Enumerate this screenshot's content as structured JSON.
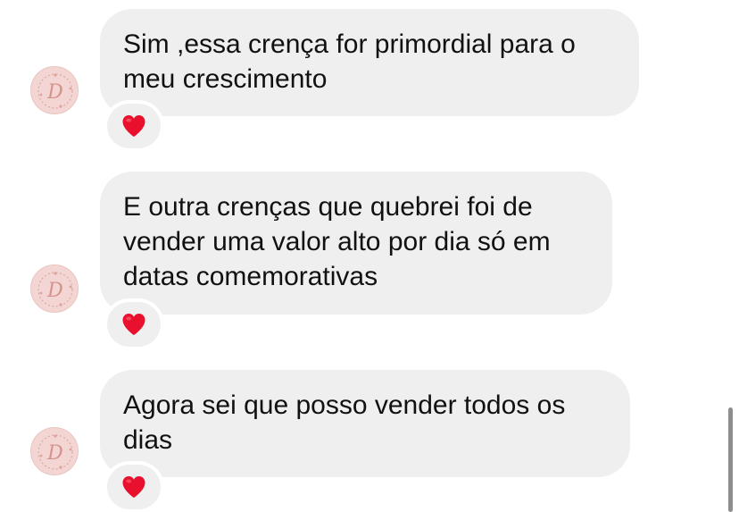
{
  "conversation": {
    "messages": [
      {
        "text": "Sim ,essa crença for primordial para o meu crescimento",
        "reaction": "red-heart"
      },
      {
        "text": "E outra crenças que quebrei foi de vender uma valor alto por dia só em datas comemorativas",
        "reaction": "red-heart"
      },
      {
        "text": "Agora sei que posso vender todos os dias",
        "reaction": "red-heart"
      }
    ],
    "avatar_monogram": "D"
  },
  "colors": {
    "bubble_background": "#efefef",
    "text": "#111111",
    "heart": "#e8102c",
    "avatar_background": "#f3d6d3",
    "avatar_ink": "#d6928c"
  }
}
